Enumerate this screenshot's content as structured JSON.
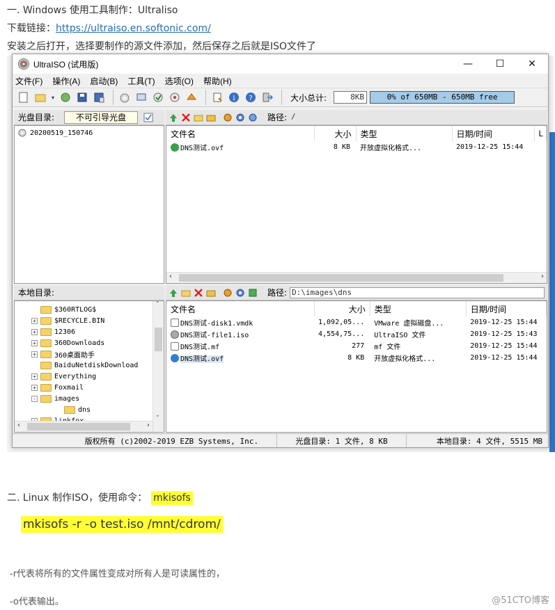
{
  "article": {
    "heading1": "一. Windows 使用工具制作：Ultraliso",
    "download_label": "下载链接：",
    "download_url": "https://ultraiso.en.softonic.com/",
    "instruction": "安装之后打开，选择要制作的源文件添加，然后保存之后就是ISO文件了",
    "heading2_prefix": "二. Linux 制作ISO，使用命令：",
    "heading2_cmd": "mkisofs",
    "command": "mkisofs -r -o test.iso /mnt/cdrom/",
    "note1": "-r代表将所有的文件属性变成对所有人是可读属性的，",
    "note2": "-o代表输出。",
    "watermark": "@51CTO博客"
  },
  "window": {
    "title": "UltraISO (试用版)",
    "menu": [
      "文件(F)",
      "操作(A)",
      "启动(B)",
      "工具(T)",
      "选项(O)",
      "帮助(H)"
    ],
    "toolbar": {
      "size_label": "大小总计:",
      "size_value": "8KB",
      "capacity_text": "0% of 650MB - 650MB free",
      "capacity_fraction": 0.0
    },
    "iso_pane": {
      "label": "光盘目录:",
      "boot_combo": "不可引导光盘",
      "tree_root": "20200519_150746",
      "path_label": "路径:",
      "path_value": "/",
      "columns": [
        "文件名",
        "大小",
        "类型",
        "日期/时间",
        "L"
      ],
      "files": [
        {
          "name": "DNS测试.ovf",
          "size": "8 KB",
          "type": "开放虚拟化格式...",
          "date": "2019-12-25 15:44"
        }
      ]
    },
    "local_pane": {
      "label": "本地目录:",
      "path_label": "路径:",
      "path_value": "D:\\images\\dns",
      "tree": [
        {
          "name": "$360RTLOG$",
          "expand": ""
        },
        {
          "name": "$RECYCLE.BIN",
          "expand": "+"
        },
        {
          "name": "12306",
          "expand": "+"
        },
        {
          "name": "360Downloads",
          "expand": "+"
        },
        {
          "name": "360桌面助手",
          "expand": "+"
        },
        {
          "name": "BaiduNetdiskDownload",
          "expand": ""
        },
        {
          "name": "Everything",
          "expand": "+"
        },
        {
          "name": "Foxmail",
          "expand": "+"
        },
        {
          "name": "images",
          "expand": "-"
        },
        {
          "name": "dns",
          "expand": ""
        },
        {
          "name": "linkfox",
          "expand": "+"
        }
      ],
      "columns": [
        "文件名",
        "大小",
        "类型",
        "日期/时间"
      ],
      "files": [
        {
          "name": "DNS测试-disk1.vmdk",
          "size": "1,092,05...",
          "type": "VMware 虚拟磁盘...",
          "date": "2019-12-25 15:44"
        },
        {
          "name": "DNS测试-file1.iso",
          "size": "4,554,75...",
          "type": "UltraISO 文件",
          "date": "2019-12-25 15:43"
        },
        {
          "name": "DNS测试.mf",
          "size": "277",
          "type": "mf 文件",
          "date": "2019-12-25 15:44"
        },
        {
          "name": "DNS测试.ovf",
          "size": "8 KB",
          "type": "开放虚拟化格式...",
          "date": "2019-12-25 15:44"
        }
      ]
    },
    "status": {
      "copyright": "版权所有 (c)2002-2019 EZB Systems, Inc.",
      "iso_info": "光盘目录: 1 文件, 8 KB",
      "local_info": "本地目录: 4 文件, 5515 MB"
    }
  }
}
